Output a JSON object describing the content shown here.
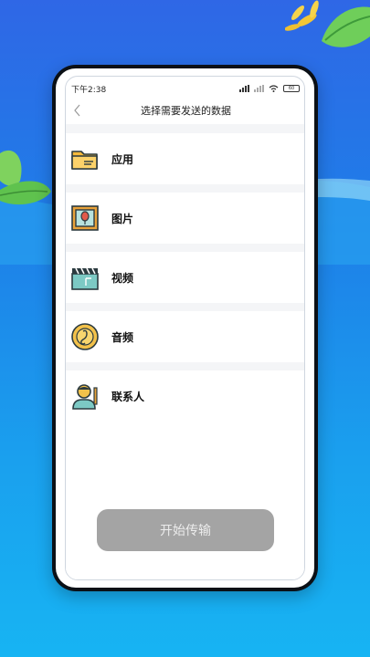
{
  "status_bar": {
    "time": "下午2:38",
    "battery": "60"
  },
  "header": {
    "title": "选择需要发送的数据"
  },
  "items": [
    {
      "label": "应用",
      "icon": "folder-icon"
    },
    {
      "label": "图片",
      "icon": "picture-icon"
    },
    {
      "label": "视频",
      "icon": "clapperboard-icon"
    },
    {
      "label": "音频",
      "icon": "music-disc-icon"
    },
    {
      "label": "联系人",
      "icon": "contact-person-icon"
    }
  ],
  "start_button": {
    "label": "开始传输"
  },
  "colors": {
    "background_top": "#2f67e6",
    "background_bottom": "#17b4f3",
    "button_disabled": "#a4a4a4",
    "icon_outline": "#2b3a3f"
  }
}
